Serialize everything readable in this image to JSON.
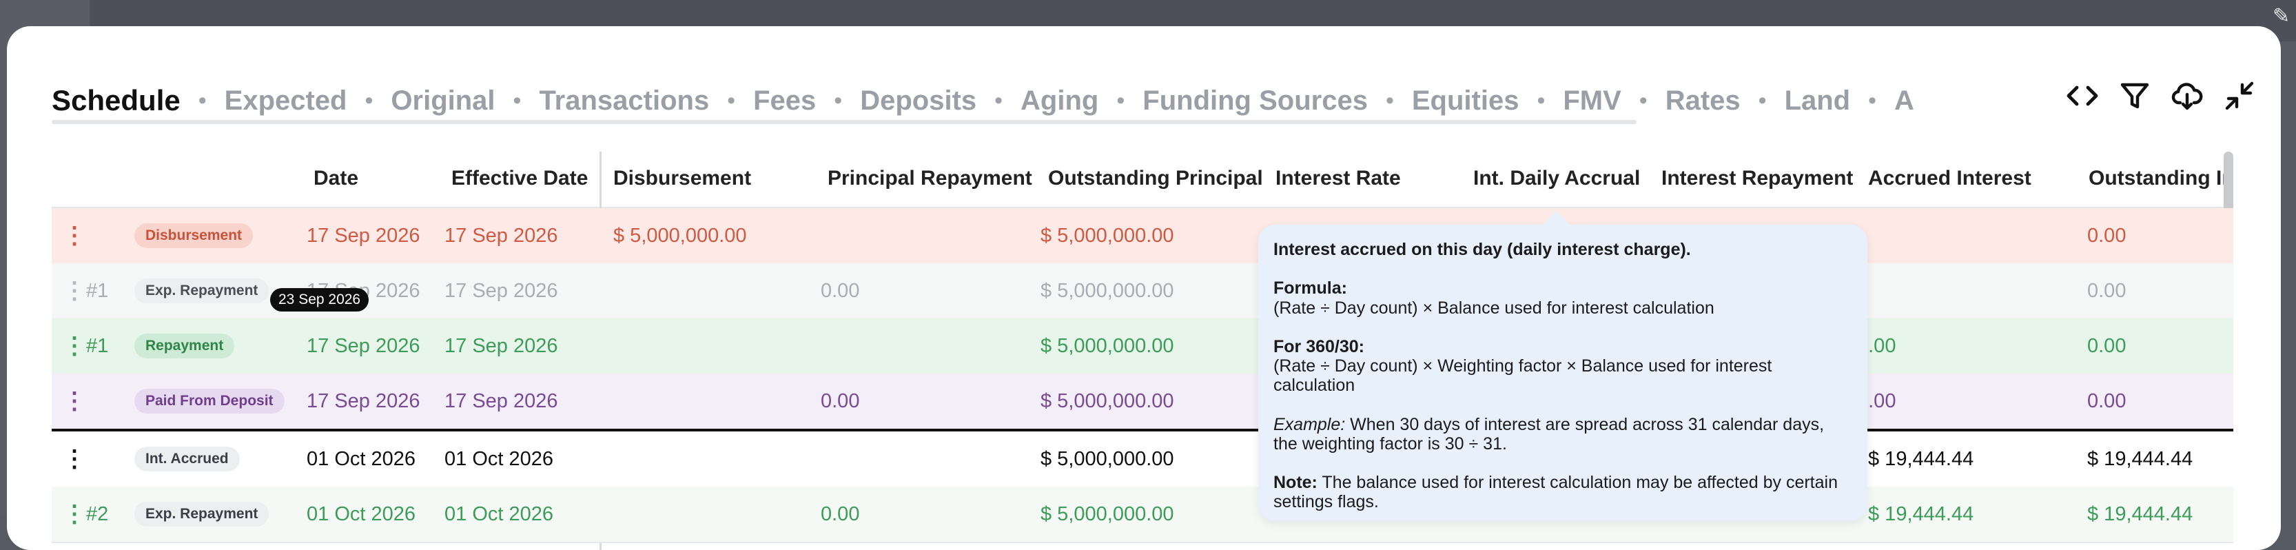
{
  "tabs": [
    "Schedule",
    "Expected",
    "Original",
    "Transactions",
    "Fees",
    "Deposits",
    "Aging",
    "Funding Sources",
    "Equities",
    "FMV",
    "Rates",
    "Land",
    "A"
  ],
  "separator": "•",
  "toolbar": {
    "icons": [
      "code-icon",
      "filter-icon",
      "cloud-download-icon",
      "collapse-icon"
    ]
  },
  "columns": {
    "date": "Date",
    "effective_date": "Effective Date",
    "disbursement": "Disbursement",
    "principal_repayment": "Principal Repayment",
    "outstanding_principal": "Outstanding Principal",
    "interest_rate": "Interest Rate",
    "int_daily_accrual": "Int. Daily Accrual",
    "interest_repayment": "Interest Repayment",
    "accrued_interest": "Accrued Interest",
    "outstanding_interest": "Outstanding In"
  },
  "rows": [
    {
      "num": "",
      "type": "Disbursement",
      "date": "17 Sep 2026",
      "effective": "17 Sep 2026",
      "disbursement": "$ 5,000,000.00",
      "principal_repayment": "",
      "outstanding_principal": "$ 5,000,000.00",
      "accrued_interest": "",
      "outstanding_interest": "0.00"
    },
    {
      "num": "#1",
      "type": "Exp. Repayment",
      "date": "17 Sep 2026",
      "effective": "17 Sep 2026",
      "disbursement": "",
      "principal_repayment": "0.00",
      "outstanding_principal": "$ 5,000,000.00",
      "accrued_interest": "",
      "outstanding_interest": "0.00"
    },
    {
      "num": "#1",
      "type": "Repayment",
      "date": "17 Sep 2026",
      "effective": "17 Sep 2026",
      "disbursement": "",
      "principal_repayment": "",
      "outstanding_principal": "$ 5,000,000.00",
      "accrued_interest": "0.00",
      "outstanding_interest": "0.00"
    },
    {
      "num": "",
      "type": "Paid From Deposit",
      "date": "17 Sep 2026",
      "effective": "17 Sep 2026",
      "disbursement": "",
      "principal_repayment": "0.00",
      "outstanding_principal": "$ 5,000,000.00",
      "accrued_interest": "0.00",
      "outstanding_interest": "0.00"
    },
    {
      "num": "",
      "type": "Int. Accrued",
      "date": "01 Oct 2026",
      "effective": "01 Oct 2026",
      "disbursement": "",
      "principal_repayment": "",
      "outstanding_principal": "$ 5,000,000.00",
      "accrued_interest": "$ 19,444.44",
      "outstanding_interest": "$ 19,444.44"
    },
    {
      "num": "#2",
      "type": "Exp. Repayment",
      "date": "01 Oct 2026",
      "effective": "01 Oct 2026",
      "disbursement": "",
      "principal_repayment": "0.00",
      "outstanding_principal": "$ 5,000,000.00",
      "accrued_interest": "$ 19,444.44",
      "outstanding_interest": "$ 19,444.44"
    }
  ],
  "today_marker": "23 Sep 2026",
  "tooltip": {
    "title": "Interest accrued on this day (daily interest charge).",
    "formula_label": "Formula:",
    "formula_text": "(Rate ÷ Day count) × Balance used for interest calculation",
    "for360_label": "For 360/30:",
    "for360_text": "(Rate ÷ Day count) × Weighting factor × Balance used for interest calculation",
    "example_label": "Example:",
    "example_text": "When 30 days of interest are spread across 31 calendar days, the weighting factor is 30 ÷ 31.",
    "note_label": "Note:",
    "note_text": "The balance used for interest calculation may be affected by certain settings flags."
  },
  "colors": {
    "disbursement_bg": "#fdeae6",
    "disbursement_fg": "#cf5a43",
    "expected_bg": "#f5f7f6",
    "expected_fg": "#a9adb1",
    "repayment_bg": "#e7f5ea",
    "repayment_fg": "#3f9b59",
    "deposit_bg": "#f3eef7",
    "deposit_fg": "#7a4b95"
  }
}
